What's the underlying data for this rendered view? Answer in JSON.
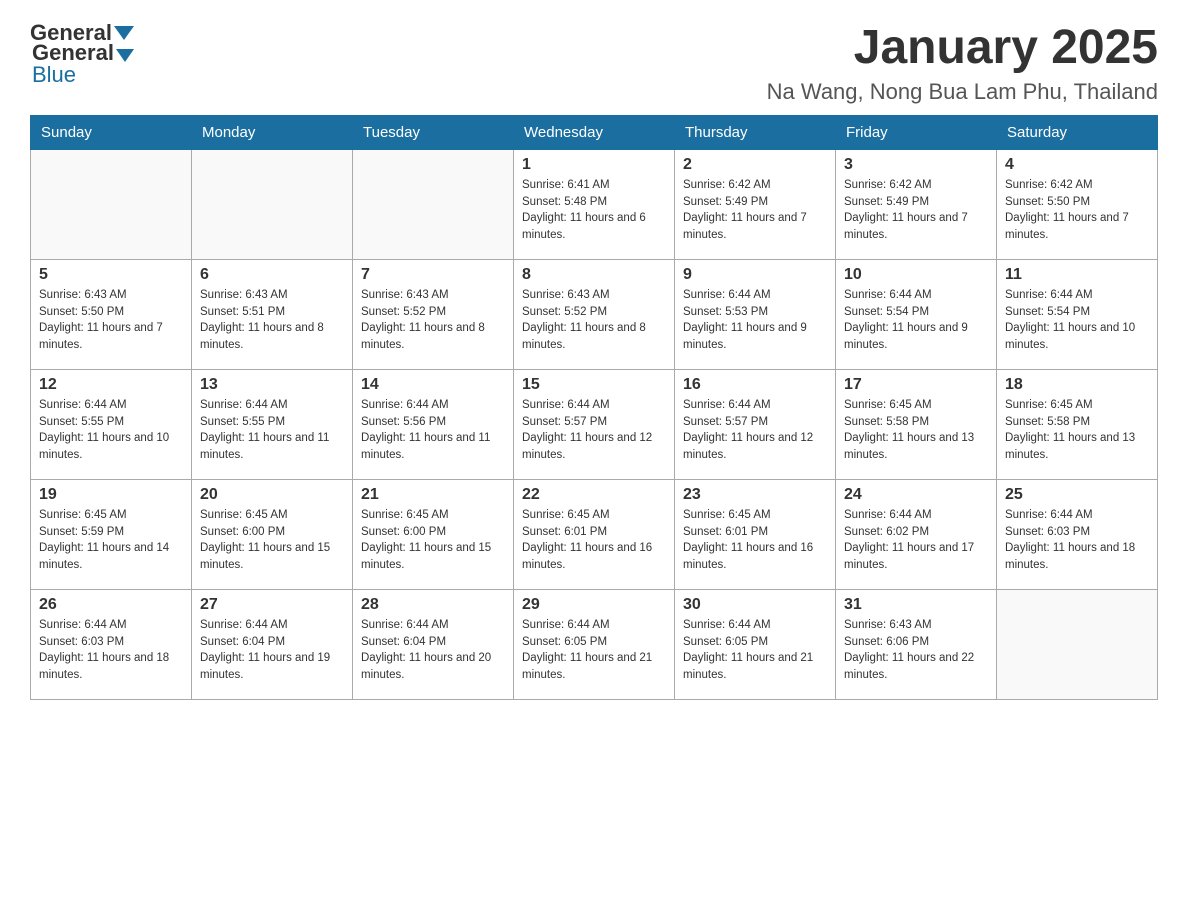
{
  "header": {
    "logo_general": "General",
    "logo_blue": "Blue",
    "month_title": "January 2025",
    "location": "Na Wang, Nong Bua Lam Phu, Thailand"
  },
  "days_of_week": [
    "Sunday",
    "Monday",
    "Tuesday",
    "Wednesday",
    "Thursday",
    "Friday",
    "Saturday"
  ],
  "weeks": [
    [
      {
        "day": "",
        "info": ""
      },
      {
        "day": "",
        "info": ""
      },
      {
        "day": "",
        "info": ""
      },
      {
        "day": "1",
        "info": "Sunrise: 6:41 AM\nSunset: 5:48 PM\nDaylight: 11 hours and 6 minutes."
      },
      {
        "day": "2",
        "info": "Sunrise: 6:42 AM\nSunset: 5:49 PM\nDaylight: 11 hours and 7 minutes."
      },
      {
        "day": "3",
        "info": "Sunrise: 6:42 AM\nSunset: 5:49 PM\nDaylight: 11 hours and 7 minutes."
      },
      {
        "day": "4",
        "info": "Sunrise: 6:42 AM\nSunset: 5:50 PM\nDaylight: 11 hours and 7 minutes."
      }
    ],
    [
      {
        "day": "5",
        "info": "Sunrise: 6:43 AM\nSunset: 5:50 PM\nDaylight: 11 hours and 7 minutes."
      },
      {
        "day": "6",
        "info": "Sunrise: 6:43 AM\nSunset: 5:51 PM\nDaylight: 11 hours and 8 minutes."
      },
      {
        "day": "7",
        "info": "Sunrise: 6:43 AM\nSunset: 5:52 PM\nDaylight: 11 hours and 8 minutes."
      },
      {
        "day": "8",
        "info": "Sunrise: 6:43 AM\nSunset: 5:52 PM\nDaylight: 11 hours and 8 minutes."
      },
      {
        "day": "9",
        "info": "Sunrise: 6:44 AM\nSunset: 5:53 PM\nDaylight: 11 hours and 9 minutes."
      },
      {
        "day": "10",
        "info": "Sunrise: 6:44 AM\nSunset: 5:54 PM\nDaylight: 11 hours and 9 minutes."
      },
      {
        "day": "11",
        "info": "Sunrise: 6:44 AM\nSunset: 5:54 PM\nDaylight: 11 hours and 10 minutes."
      }
    ],
    [
      {
        "day": "12",
        "info": "Sunrise: 6:44 AM\nSunset: 5:55 PM\nDaylight: 11 hours and 10 minutes."
      },
      {
        "day": "13",
        "info": "Sunrise: 6:44 AM\nSunset: 5:55 PM\nDaylight: 11 hours and 11 minutes."
      },
      {
        "day": "14",
        "info": "Sunrise: 6:44 AM\nSunset: 5:56 PM\nDaylight: 11 hours and 11 minutes."
      },
      {
        "day": "15",
        "info": "Sunrise: 6:44 AM\nSunset: 5:57 PM\nDaylight: 11 hours and 12 minutes."
      },
      {
        "day": "16",
        "info": "Sunrise: 6:44 AM\nSunset: 5:57 PM\nDaylight: 11 hours and 12 minutes."
      },
      {
        "day": "17",
        "info": "Sunrise: 6:45 AM\nSunset: 5:58 PM\nDaylight: 11 hours and 13 minutes."
      },
      {
        "day": "18",
        "info": "Sunrise: 6:45 AM\nSunset: 5:58 PM\nDaylight: 11 hours and 13 minutes."
      }
    ],
    [
      {
        "day": "19",
        "info": "Sunrise: 6:45 AM\nSunset: 5:59 PM\nDaylight: 11 hours and 14 minutes."
      },
      {
        "day": "20",
        "info": "Sunrise: 6:45 AM\nSunset: 6:00 PM\nDaylight: 11 hours and 15 minutes."
      },
      {
        "day": "21",
        "info": "Sunrise: 6:45 AM\nSunset: 6:00 PM\nDaylight: 11 hours and 15 minutes."
      },
      {
        "day": "22",
        "info": "Sunrise: 6:45 AM\nSunset: 6:01 PM\nDaylight: 11 hours and 16 minutes."
      },
      {
        "day": "23",
        "info": "Sunrise: 6:45 AM\nSunset: 6:01 PM\nDaylight: 11 hours and 16 minutes."
      },
      {
        "day": "24",
        "info": "Sunrise: 6:44 AM\nSunset: 6:02 PM\nDaylight: 11 hours and 17 minutes."
      },
      {
        "day": "25",
        "info": "Sunrise: 6:44 AM\nSunset: 6:03 PM\nDaylight: 11 hours and 18 minutes."
      }
    ],
    [
      {
        "day": "26",
        "info": "Sunrise: 6:44 AM\nSunset: 6:03 PM\nDaylight: 11 hours and 18 minutes."
      },
      {
        "day": "27",
        "info": "Sunrise: 6:44 AM\nSunset: 6:04 PM\nDaylight: 11 hours and 19 minutes."
      },
      {
        "day": "28",
        "info": "Sunrise: 6:44 AM\nSunset: 6:04 PM\nDaylight: 11 hours and 20 minutes."
      },
      {
        "day": "29",
        "info": "Sunrise: 6:44 AM\nSunset: 6:05 PM\nDaylight: 11 hours and 21 minutes."
      },
      {
        "day": "30",
        "info": "Sunrise: 6:44 AM\nSunset: 6:05 PM\nDaylight: 11 hours and 21 minutes."
      },
      {
        "day": "31",
        "info": "Sunrise: 6:43 AM\nSunset: 6:06 PM\nDaylight: 11 hours and 22 minutes."
      },
      {
        "day": "",
        "info": ""
      }
    ]
  ]
}
